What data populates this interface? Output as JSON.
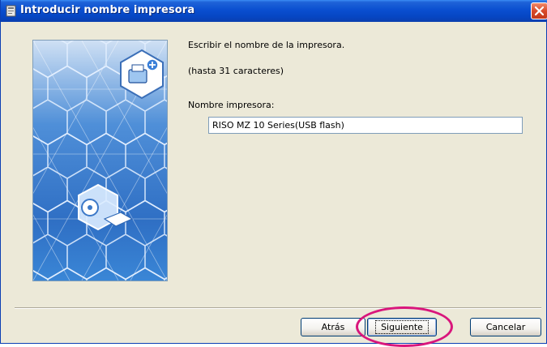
{
  "window": {
    "title": "Introducir nombre impresora",
    "title_icon": "printer-setup-icon",
    "close_icon": "close-icon"
  },
  "banner": {
    "image": "hexagon-network-illustration",
    "icons": [
      "printer-add-icon",
      "disc-device-icon"
    ]
  },
  "form": {
    "instruction": "Escribir el nombre de la impresora.",
    "limit_hint": "(hasta 31 caracteres)",
    "printer_name_label": "Nombre impresora:",
    "printer_name_value": "RISO MZ 10 Series(USB flash)"
  },
  "buttons": {
    "back_label": "Atrás",
    "next_label": "Siguiente",
    "cancel_label": "Cancelar"
  },
  "colors": {
    "title_bar": "#0a4fd0",
    "dialog_bg": "#ece9d8",
    "banner_blue": "#2f74c8",
    "highlight": "#d9167c"
  }
}
